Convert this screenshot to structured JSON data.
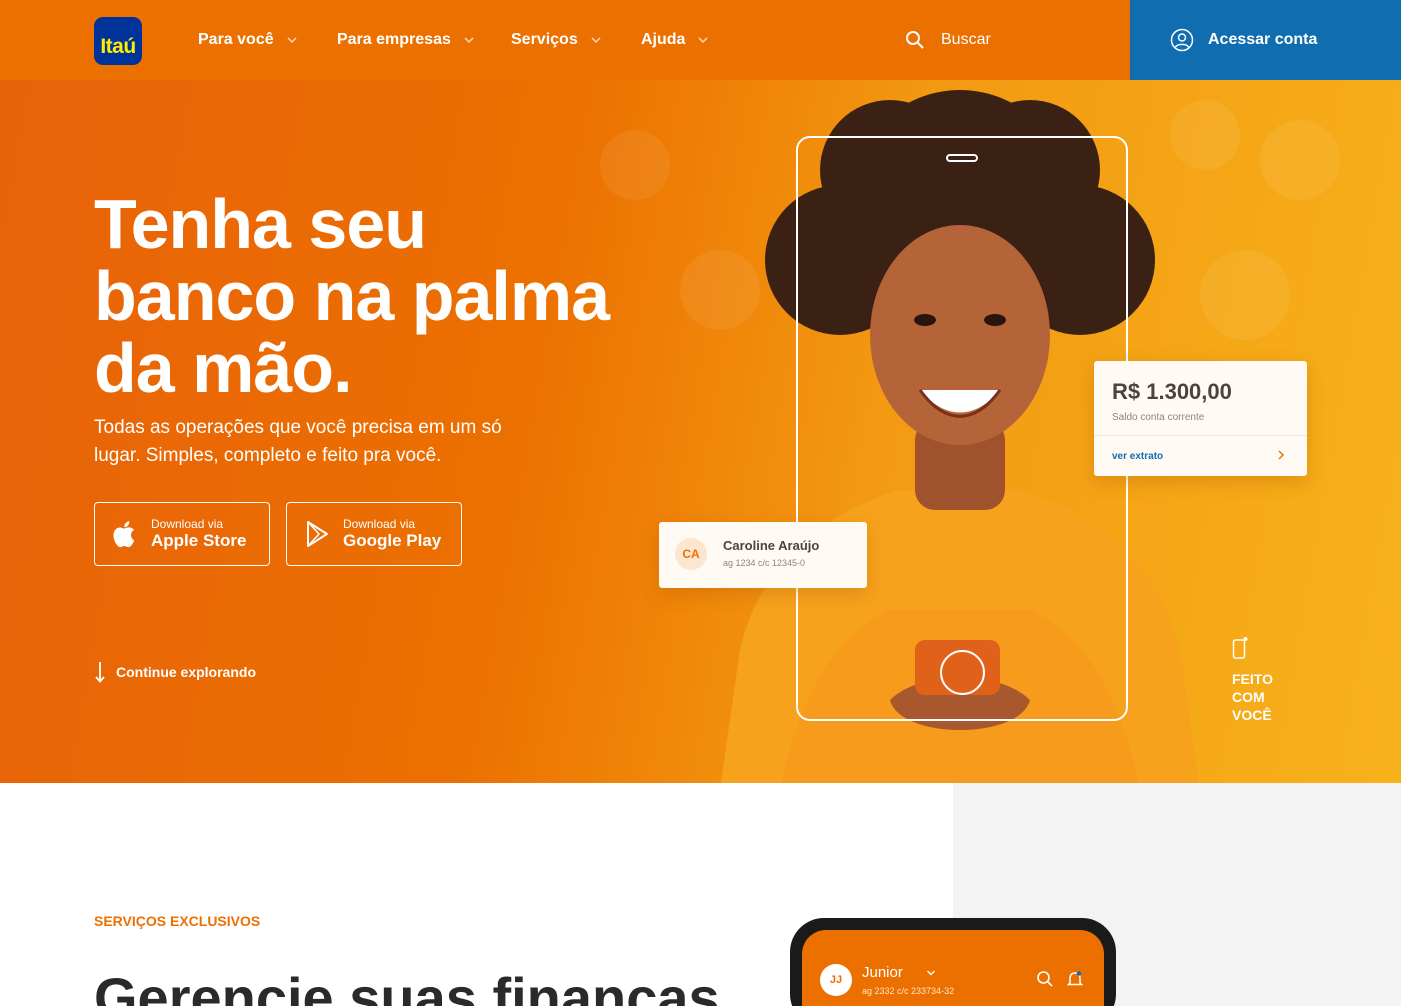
{
  "brand": {
    "logo_text": "Itaú",
    "primary_color": "#ec7000",
    "secondary_color": "#106eb0",
    "logo_bg": "#003399",
    "logo_text_color": "#ffec00"
  },
  "nav": {
    "items": [
      {
        "label": "Para você"
      },
      {
        "label": "Para empresas"
      },
      {
        "label": "Serviços"
      },
      {
        "label": "Ajuda"
      }
    ],
    "search_label": "Buscar",
    "access_label": "Acessar conta"
  },
  "hero": {
    "title": "Tenha seu\nbanco na palma\nda mão.",
    "subtitle": "Todas as operações que você precisa em um só lugar. Simples, completo e feito pra você.",
    "apple": {
      "small": "Download via",
      "big": "Apple Store"
    },
    "google": {
      "small": "Download via",
      "big": "Google Play"
    },
    "explore_label": "Continue explorando",
    "balance_card": {
      "amount": "R$ 1.300,00",
      "label": "Saldo conta corrente",
      "link": "ver extrato"
    },
    "contact_card": {
      "initials": "CA",
      "name": "Caroline Araújo",
      "account": "ag 1234  c/c 12345-0"
    },
    "feito_label": "FEITO\nCOM\nVOCÊ"
  },
  "services": {
    "eyebrow": "SERVIÇOS EXCLUSIVOS",
    "heading": "Gerencie suas finanças",
    "phone": {
      "initials": "JJ",
      "name": "Junior",
      "account": "ag 2332    c/c 233734-32"
    }
  }
}
